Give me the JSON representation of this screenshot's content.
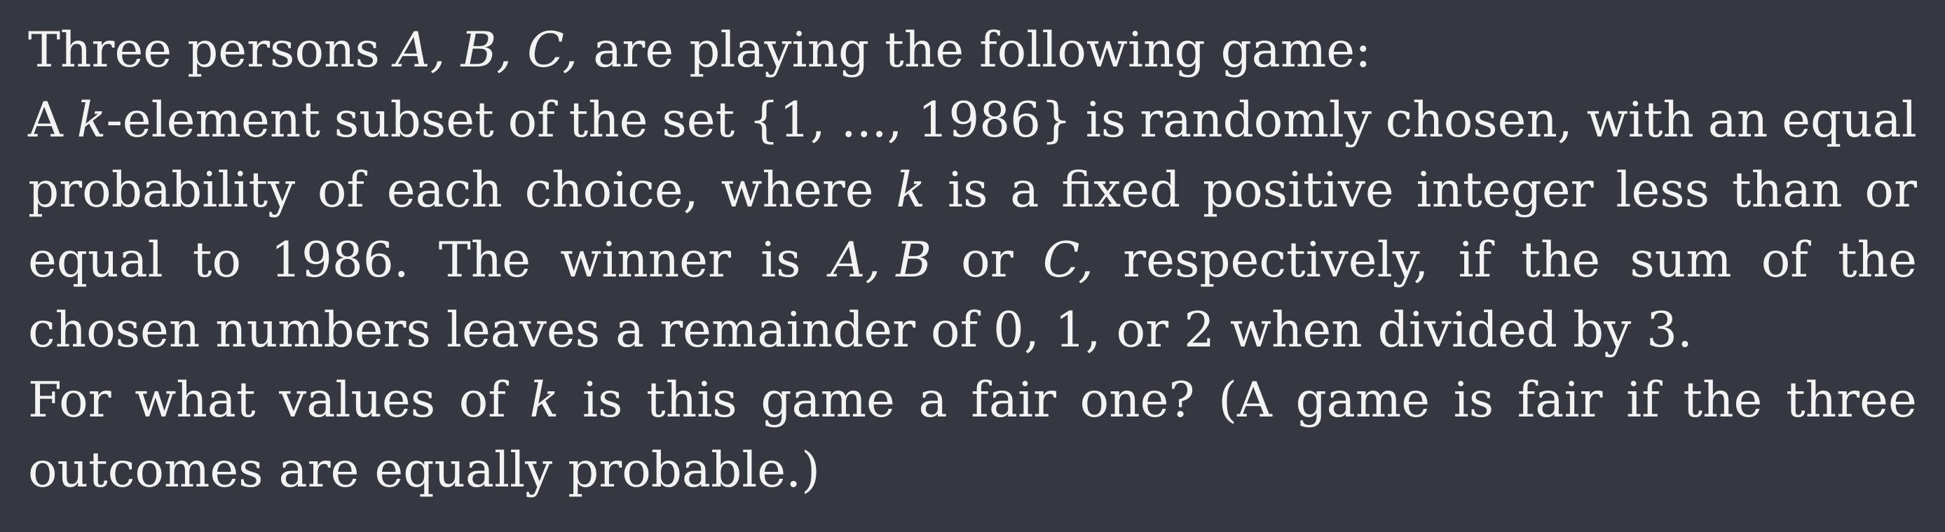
{
  "problem": {
    "lines": [
      {
        "words": [
          "Three",
          "persons",
          "A, B, C,",
          "are",
          "playing",
          "the",
          "following",
          "game:"
        ],
        "justified": false
      },
      {
        "words": [
          "A",
          "k-element",
          "subset",
          "of",
          "the",
          "set",
          "{1, ..., 1986}",
          "is",
          "randomly",
          "chosen,",
          "with",
          "an",
          "equal"
        ],
        "justified": true
      },
      {
        "words": [
          "probability",
          "of",
          "each",
          "choice,",
          "where",
          "k",
          "is",
          "a",
          "fixed",
          "positive",
          "integer",
          "less",
          "than",
          "or"
        ],
        "justified": true
      },
      {
        "words": [
          "equal",
          "to",
          "1986.",
          "The",
          "winner",
          "is",
          "A, B",
          "or",
          "C,",
          "respectively,",
          "if",
          "the",
          "sum",
          "of",
          "the"
        ],
        "justified": true
      },
      {
        "words": [
          "chosen",
          "numbers",
          "leaves",
          "a",
          "remainder",
          "of",
          "0, 1,",
          "or",
          "2",
          "when",
          "divided",
          "by",
          "3."
        ],
        "justified": false
      },
      {
        "words": [
          "For",
          "what",
          "values",
          "of",
          "k",
          "is",
          "this",
          "game",
          "a",
          "fair",
          "one?",
          "(A",
          "game",
          "is",
          "fair",
          "if",
          "the",
          "three"
        ],
        "justified": true
      },
      {
        "words": [
          "outcomes",
          "are",
          "equally",
          "probable.)"
        ],
        "justified": false
      }
    ],
    "italic_words": [
      "A, B, C,",
      "A, B",
      "C,",
      "k"
    ]
  }
}
